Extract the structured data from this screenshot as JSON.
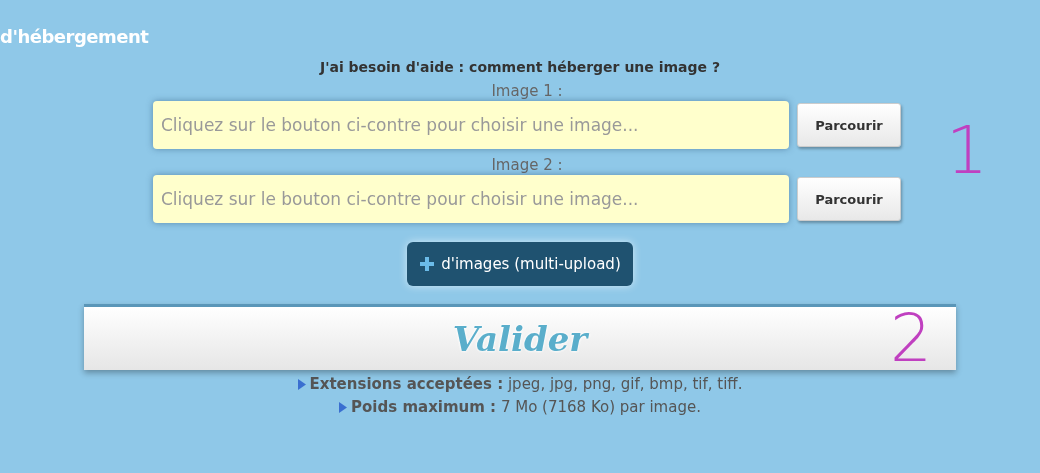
{
  "header": {
    "title": "d'hébergement"
  },
  "help_link": "J'ai besoin d'aide : comment héberger une image ?",
  "files": [
    {
      "label": "Image 1 :",
      "placeholder": "Cliquez sur le bouton ci-contre pour choisir une image...",
      "button": "Parcourir"
    },
    {
      "label": "Image 2 :",
      "placeholder": "Cliquez sur le bouton ci-contre pour choisir une image...",
      "button": "Parcourir"
    }
  ],
  "multi_upload_button": "d'images (multi-upload)",
  "submit_button": "Valider",
  "info": [
    "**Extensions acceptées :** jpeg, jpg, png, gif, bmp, tif, tiff.",
    "**Poids maximum :** 7 Mo (7168 Ko) par image."
  ],
  "annotations": [
    "1",
    "2"
  ]
}
